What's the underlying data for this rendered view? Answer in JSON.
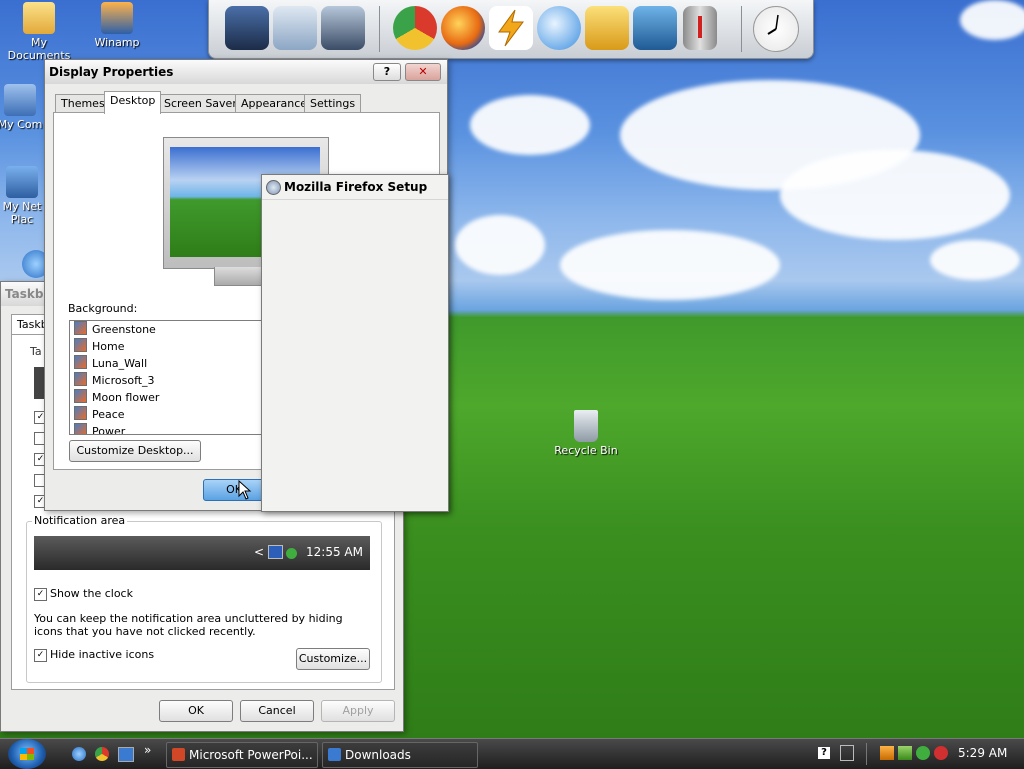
{
  "desktop": {
    "icons": [
      {
        "label": "My Documents"
      },
      {
        "label": "Winamp"
      },
      {
        "label": "My Com"
      },
      {
        "label": "My Net Plac"
      },
      {
        "label": "Recycle Bin"
      }
    ]
  },
  "display_properties": {
    "title": "Display Properties",
    "help_glyph": "?",
    "close_glyph": "✕",
    "tabs": [
      "Themes",
      "Desktop",
      "Screen Saver",
      "Appearance",
      "Settings"
    ],
    "background_label": "Background:",
    "background_items": [
      "Greenstone",
      "Home",
      "Luna_Wall",
      "Microsoft_3",
      "Moon flower",
      "Peace",
      "Power"
    ],
    "customize_desktop": "Customize Desktop...",
    "ok_label": "OK"
  },
  "firefox_setup": {
    "title": "Mozilla Firefox Setup"
  },
  "taskbar_props": {
    "title": "Taskba",
    "tab": "Taskb",
    "group_letter": "Ta",
    "notification_area_label": "Notification area",
    "preview_time": "12:55 AM",
    "preview_chevron": "<",
    "show_clock_label": "Show the clock",
    "show_clock_checked": true,
    "info_text": "You can keep the notification area uncluttered by hiding icons that you have not clicked recently.",
    "hide_inactive_label": "Hide inactive icons",
    "hide_inactive_checked": true,
    "customize_label": "Customize...",
    "ok_label": "OK",
    "cancel_label": "Cancel",
    "apply_label": "Apply",
    "check_glyph": "✓"
  },
  "taskbar": {
    "quick_launch_more": "»",
    "items": [
      "Microsoft PowerPoi...",
      "Downloads"
    ],
    "clock": "5:29 AM",
    "tray_help": "?"
  },
  "colors": {
    "taskbar": "#262626",
    "accent_selected": "#3d8ee0"
  }
}
